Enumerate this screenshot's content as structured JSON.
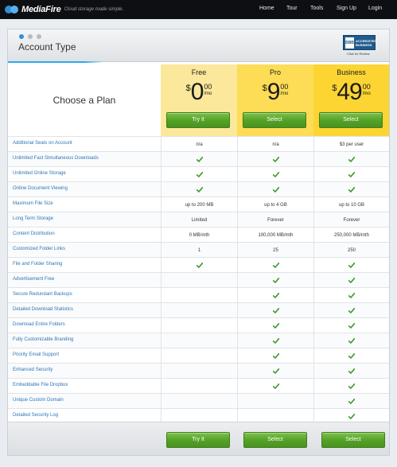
{
  "brand": {
    "name": "MediaFire",
    "tagline": "Cloud storage made simple."
  },
  "nav": [
    "Home",
    "Tour",
    "Tools",
    "Sign Up",
    "Login"
  ],
  "panel": {
    "title": "Account Type",
    "badge": {
      "seal": "BBB",
      "line1": "ACCREDITED",
      "line2": "BUSINESS",
      "click": "Click for Review"
    }
  },
  "choose_label": "Choose a Plan",
  "plans": [
    {
      "name": "Free",
      "currency": "$",
      "integer": "0",
      "cents": "00",
      "period": "/mo",
      "button": "Try It",
      "bottom_button": "Try It"
    },
    {
      "name": "Pro",
      "currency": "$",
      "integer": "9",
      "cents": "00",
      "period": "/mo",
      "button": "Select",
      "bottom_button": "Select"
    },
    {
      "name": "Business",
      "currency": "$",
      "integer": "49",
      "cents": "00",
      "period": "/mo",
      "button": "Select",
      "bottom_button": "Select"
    }
  ],
  "features": [
    {
      "label": "Additional Seats on Account",
      "values": [
        "n/a",
        "n/a",
        "$3 per user"
      ]
    },
    {
      "label": "Unlimited Fast Simultaneous Downloads",
      "values": [
        "check",
        "check",
        "check"
      ]
    },
    {
      "label": "Unlimited Online Storage",
      "values": [
        "check",
        "check",
        "check"
      ]
    },
    {
      "label": "Online Document Viewing",
      "values": [
        "check",
        "check",
        "check"
      ]
    },
    {
      "label": "Maximum File Size",
      "values": [
        "up to 200 MB",
        "up to 4 GB",
        "up to 10 GB"
      ]
    },
    {
      "label": "Long Term Storage",
      "values": [
        "Limited",
        "Forever",
        "Forever"
      ]
    },
    {
      "label": "Content Distribution",
      "values": [
        "0 MB/mth",
        "100,000 MB/mth",
        "250,000 MB/mth"
      ]
    },
    {
      "label": "Customized Folder Links",
      "values": [
        "1",
        "25",
        "250"
      ]
    },
    {
      "label": "File and Folder Sharing",
      "values": [
        "check",
        "check",
        "check"
      ]
    },
    {
      "label": "Advertisement Free",
      "values": [
        "",
        "check",
        "check"
      ]
    },
    {
      "label": "Secure Redundant Backups",
      "values": [
        "",
        "check",
        "check"
      ]
    },
    {
      "label": "Detailed Download Statistics",
      "values": [
        "",
        "check",
        "check"
      ]
    },
    {
      "label": "Download Entire Folders",
      "values": [
        "",
        "check",
        "check"
      ]
    },
    {
      "label": "Fully Customizable Branding",
      "values": [
        "",
        "check",
        "check"
      ]
    },
    {
      "label": "Priority Email Support",
      "values": [
        "",
        "check",
        "check"
      ]
    },
    {
      "label": "Enhanced Security",
      "values": [
        "",
        "check",
        "check"
      ]
    },
    {
      "label": "Embeddable File Dropbox",
      "values": [
        "",
        "check",
        "check"
      ]
    },
    {
      "label": "Unique Custom Domain",
      "values": [
        "",
        "",
        "check"
      ]
    },
    {
      "label": "Detailed Security Log",
      "values": [
        "",
        "",
        "check"
      ]
    }
  ],
  "colors": {
    "check": "#3c9a2a",
    "feature_link": "#2d76b7",
    "accent": "#2e8fdc"
  }
}
